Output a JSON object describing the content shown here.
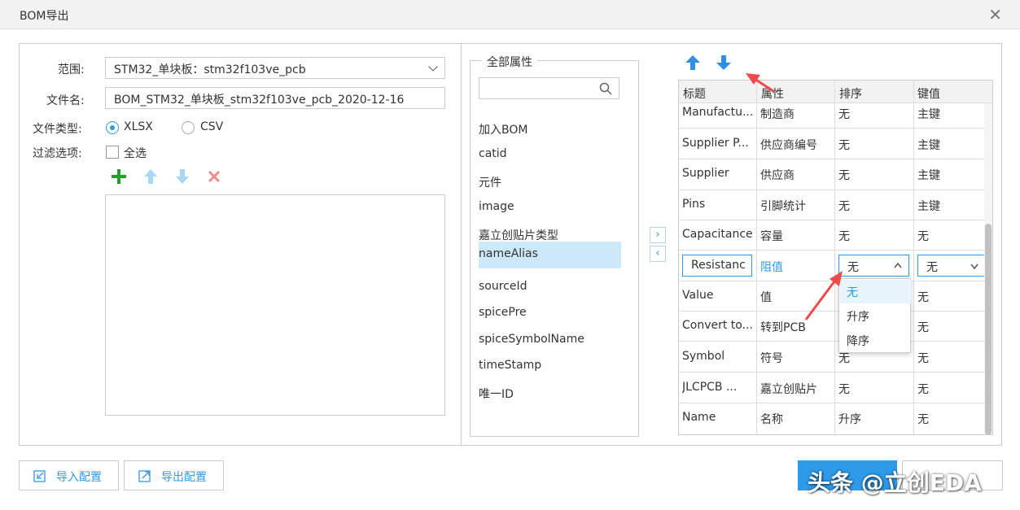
{
  "dialog": {
    "title": "BOM导出",
    "close_symbol": "✕"
  },
  "form": {
    "scope_label": "范围:",
    "scope_value": "STM32_单块板：stm32f103ve_pcb",
    "filename_label": "文件名:",
    "filename_value": "BOM_STM32_单块板_stm32f103ve_pcb_2020-12-16",
    "filetype_label": "文件类型:",
    "filetype_xlsx": "XLSX",
    "filetype_csv": "CSV",
    "filetype_selected": "XLSX",
    "filter_label": "过滤选项:",
    "select_all_label": "全选"
  },
  "attributes": {
    "legend": "全部属性",
    "search_placeholder": "",
    "items": [
      {
        "label": "加入BOM"
      },
      {
        "label": "catid"
      },
      {
        "label": "元件"
      },
      {
        "label": "image"
      },
      {
        "label": "嘉立创贴片类型"
      },
      {
        "label": "nameAlias"
      },
      {
        "label": "sourceId"
      },
      {
        "label": "spicePre"
      },
      {
        "label": "spiceSymbolName"
      },
      {
        "label": "timeStamp"
      },
      {
        "label": "唯一ID"
      }
    ],
    "selected_index": 5
  },
  "table": {
    "headers": {
      "title": "标题",
      "attr": "属性",
      "sort": "排序",
      "key": "键值"
    },
    "rows": [
      {
        "title": "Manufactu...",
        "attr": "制造商",
        "sort": "无",
        "key": "主键"
      },
      {
        "title": "Supplier P...",
        "attr": "供应商编号",
        "sort": "无",
        "key": "主键"
      },
      {
        "title": "Supplier",
        "attr": "供应商",
        "sort": "无",
        "key": "主键"
      },
      {
        "title": "Pins",
        "attr": "引脚统计",
        "sort": "无",
        "key": "主键"
      },
      {
        "title": "Capacitance",
        "attr": "容量",
        "sort": "无",
        "key": "无"
      },
      {
        "title": "Resistanc",
        "attr": "阻值",
        "sort": "无",
        "key": "无"
      },
      {
        "title": "Value",
        "attr": "值",
        "sort": "",
        "key": "无"
      },
      {
        "title": "Convert to...",
        "attr": "转到PCB",
        "sort": "",
        "key": "无"
      },
      {
        "title": "Symbol",
        "attr": "符号",
        "sort": "无",
        "key": "无"
      },
      {
        "title": "JLCPCB ...",
        "attr": "嘉立创贴片",
        "sort": "无",
        "key": "无"
      },
      {
        "title": "Name",
        "attr": "名称",
        "sort": "升序",
        "key": "无"
      }
    ],
    "editing_row_index": 5,
    "sort_options": [
      "无",
      "升序",
      "降序"
    ],
    "sort_selected": "无"
  },
  "footer": {
    "import_label": "导入配置",
    "export_label": "导出配置",
    "watermark": "头条 @立创EDA"
  },
  "colors": {
    "accent": "#2f9ae8",
    "add_green": "#22a02a",
    "delete_red": "#f08b8b",
    "arrow_red": "#f04a4a",
    "selection_bg": "#cce8f9"
  }
}
